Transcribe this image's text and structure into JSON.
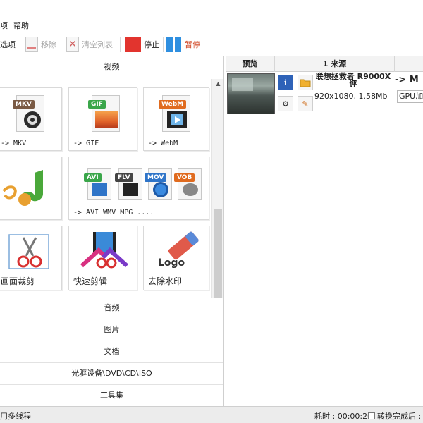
{
  "menu": {
    "item_partial": "项",
    "help": "帮助"
  },
  "toolbar": {
    "options_partial": "选项",
    "remove": "移除",
    "clear_list": "清空列表",
    "stop": "停止",
    "pause": "暂停"
  },
  "left_panel": {
    "video_header": "视频",
    "tiles": [
      {
        "label": "-> MKV",
        "badge": "MKV"
      },
      {
        "label": "-> GIF",
        "badge": "GIF"
      },
      {
        "label": "-> WebM",
        "badge": "WebM"
      },
      {
        "label": "-> AVI WMV MPG ....",
        "badges": [
          "AVI",
          "FLV",
          "MOV",
          "VOB"
        ]
      },
      {
        "label": "画面裁剪"
      },
      {
        "label": "快速剪辑"
      },
      {
        "label": "去除水印",
        "logo_text": "Logo"
      }
    ],
    "categories": [
      "音频",
      "图片",
      "文档",
      "光驱设备\\DVD\\CD\\ISO",
      "工具集"
    ]
  },
  "file_list": {
    "headers": {
      "preview": "预览",
      "source": "1 来源"
    },
    "rows": [
      {
        "source_name": "联想拯救者 R9000X评",
        "source_info": "920x1080, 1.58Mb",
        "target": "-> M",
        "gpu": "GPU加"
      }
    ]
  },
  "status_bar": {
    "left_text": "用多线程",
    "elapsed_label": "耗时 : 00:00:20",
    "after_convert": "转换完成后 :"
  },
  "colors": {
    "stop_red": "#e2342e",
    "pause_blue": "#2f8fe0",
    "pause_text": "#d24a28",
    "mkv_tag": "#7a5a44",
    "gif_tag": "#3aa64a",
    "webm_tag": "#e06b1f"
  }
}
